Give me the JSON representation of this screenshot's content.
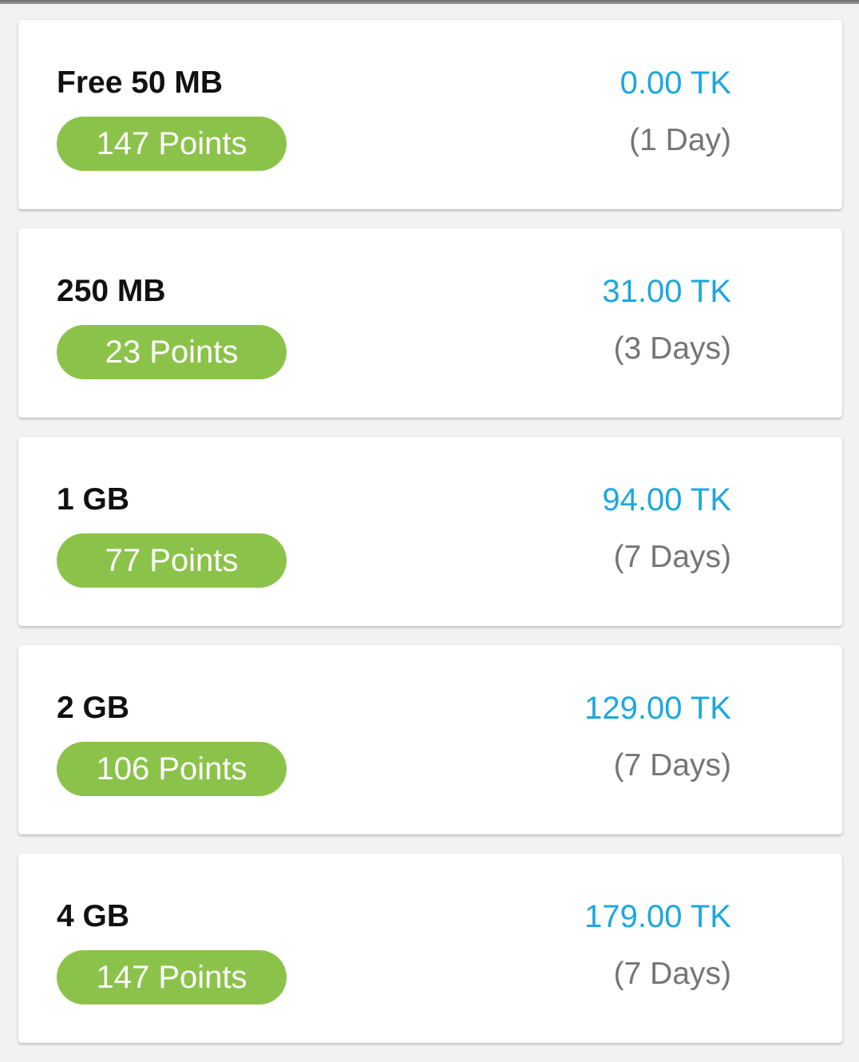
{
  "packs": [
    {
      "name": "Free 50 MB",
      "points": "147 Points",
      "price": "0.00 TK",
      "validity": "(1 Day)"
    },
    {
      "name": "250 MB",
      "points": "23 Points",
      "price": "31.00 TK",
      "validity": "(3 Days)"
    },
    {
      "name": "1 GB",
      "points": "77 Points",
      "price": "94.00 TK",
      "validity": "(7 Days)"
    },
    {
      "name": "2 GB",
      "points": "106 Points",
      "price": "129.00 TK",
      "validity": "(7 Days)"
    },
    {
      "name": "4 GB",
      "points": "147 Points",
      "price": "179.00 TK",
      "validity": "(7 Days)"
    }
  ],
  "colors": {
    "price": "#1ba7e0",
    "points_pill": "#8bc34a",
    "validity": "#757575",
    "background": "#f2f2f2"
  }
}
